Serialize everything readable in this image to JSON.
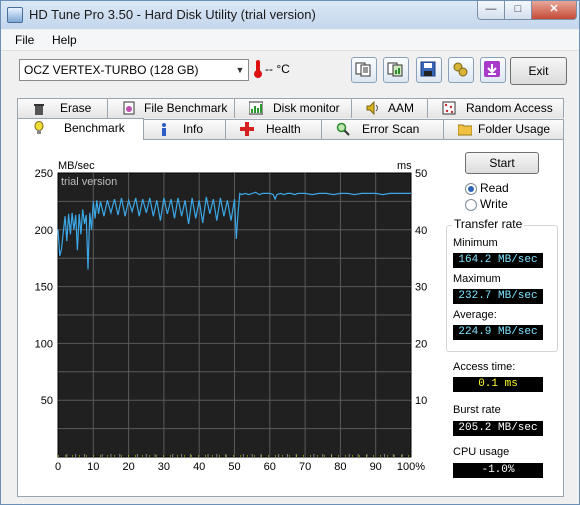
{
  "window": {
    "title": "HD Tune Pro 3.50 - Hard Disk Utility (trial version)"
  },
  "menu": {
    "items": [
      "File",
      "Help"
    ]
  },
  "toolbar": {
    "drive": "OCZ VERTEX-TURBO (128 GB)",
    "temperature": "-- °C",
    "exit_label": "Exit",
    "buttons": [
      "copy-text-icon",
      "copy-screenshot-icon",
      "save-icon",
      "options-icon",
      "download-icon"
    ]
  },
  "tabs_top": [
    "Erase",
    "File Benchmark",
    "Disk monitor",
    "AAM",
    "Random Access"
  ],
  "tabs_bottom": [
    "Benchmark",
    "Info",
    "Health",
    "Error Scan",
    "Folder Usage"
  ],
  "panel": {
    "start_label": "Start",
    "read_label": "Read",
    "write_label": "Write",
    "transfer_rate_label": "Transfer rate",
    "minimum_label": "Minimum",
    "minimum_value": "164.2 MB/sec",
    "maximum_label": "Maximum",
    "maximum_value": "232.7 MB/sec",
    "average_label": "Average:",
    "average_value": "224.9 MB/sec",
    "access_time_label": "Access time:",
    "access_time_value": "0.1 ms",
    "burst_rate_label": "Burst rate",
    "burst_rate_value": "205.2 MB/sec",
    "cpu_usage_label": "CPU usage",
    "cpu_usage_value": "-1.0%"
  },
  "colors": {
    "chart_bg": "#202020",
    "grid": "#5a5a5a",
    "series": "#3ba7e6",
    "access": "#e8e800"
  },
  "chart_data": {
    "type": "line",
    "watermark": "trial version",
    "ylabel_left": "MB/sec",
    "ylabel_right": "ms",
    "y_left_ticks": [
      50,
      100,
      150,
      200,
      250
    ],
    "y_right_ticks": [
      10,
      20,
      30,
      40,
      50
    ],
    "x_ticks": [
      "0",
      "10",
      "20",
      "30",
      "40",
      "50",
      "60",
      "70",
      "80",
      "90",
      "100%"
    ],
    "ylim": [
      0,
      250
    ],
    "y2lim": [
      0,
      50
    ],
    "xlim": [
      0,
      100
    ],
    "series": [
      {
        "values": [
          [
            0,
            200
          ],
          [
            0.5,
            177
          ],
          [
            1,
            183
          ],
          [
            1.5,
            198
          ],
          [
            2,
            212
          ],
          [
            2.5,
            190
          ],
          [
            3,
            214
          ],
          [
            3.5,
            196
          ],
          [
            4,
            215
          ],
          [
            4.5,
            200
          ],
          [
            5,
            213
          ],
          [
            5.5,
            182
          ],
          [
            6,
            214
          ],
          [
            6.5,
            196
          ],
          [
            7,
            218
          ],
          [
            7.5,
            205
          ],
          [
            8,
            213
          ],
          [
            8.5,
            165
          ],
          [
            9,
            215
          ],
          [
            9.5,
            200
          ],
          [
            10,
            225
          ],
          [
            10.5,
            210
          ],
          [
            11,
            226
          ],
          [
            11.5,
            214
          ],
          [
            12,
            225
          ],
          [
            13,
            212
          ],
          [
            14,
            226
          ],
          [
            15,
            215
          ],
          [
            16,
            227
          ],
          [
            17,
            213
          ],
          [
            18,
            228
          ],
          [
            19,
            212
          ],
          [
            20,
            226
          ],
          [
            21,
            216
          ],
          [
            22,
            228
          ],
          [
            23,
            212
          ],
          [
            24,
            227
          ],
          [
            25,
            215
          ],
          [
            26,
            228
          ],
          [
            27,
            212
          ],
          [
            28,
            226
          ],
          [
            29,
            208
          ],
          [
            30,
            228
          ],
          [
            31,
            214
          ],
          [
            32,
            227
          ],
          [
            33,
            210
          ],
          [
            34,
            228
          ],
          [
            35,
            212
          ],
          [
            36,
            226
          ],
          [
            37,
            205
          ],
          [
            38,
            228
          ],
          [
            39,
            210
          ],
          [
            40,
            226
          ],
          [
            41,
            206
          ],
          [
            42,
            229
          ],
          [
            43,
            214
          ],
          [
            44,
            227
          ],
          [
            45,
            208
          ],
          [
            46,
            228
          ],
          [
            47,
            212
          ],
          [
            48,
            226
          ],
          [
            49,
            208
          ],
          [
            50,
            227
          ],
          [
            50.5,
            192
          ],
          [
            51,
            214
          ],
          [
            51.5,
            232
          ],
          [
            52,
            231
          ],
          [
            53,
            232
          ],
          [
            54,
            231
          ],
          [
            55,
            232
          ],
          [
            56,
            233
          ],
          [
            57,
            231
          ],
          [
            58,
            232
          ],
          [
            59,
            232
          ],
          [
            60,
            232
          ],
          [
            61,
            231
          ],
          [
            61.5,
            227
          ],
          [
            62,
            231
          ],
          [
            63,
            232
          ],
          [
            64,
            231
          ],
          [
            65,
            232
          ],
          [
            66,
            232
          ],
          [
            67,
            231
          ],
          [
            68,
            232
          ],
          [
            70,
            232
          ],
          [
            72,
            231
          ],
          [
            74,
            232
          ],
          [
            76,
            232
          ],
          [
            78,
            231
          ],
          [
            80,
            232
          ],
          [
            82,
            232
          ],
          [
            84,
            231
          ],
          [
            86,
            232
          ],
          [
            88,
            232
          ],
          [
            90,
            232
          ],
          [
            92,
            231
          ],
          [
            94,
            232
          ],
          [
            96,
            232
          ],
          [
            98,
            232
          ],
          [
            100,
            232
          ]
        ]
      }
    ]
  }
}
